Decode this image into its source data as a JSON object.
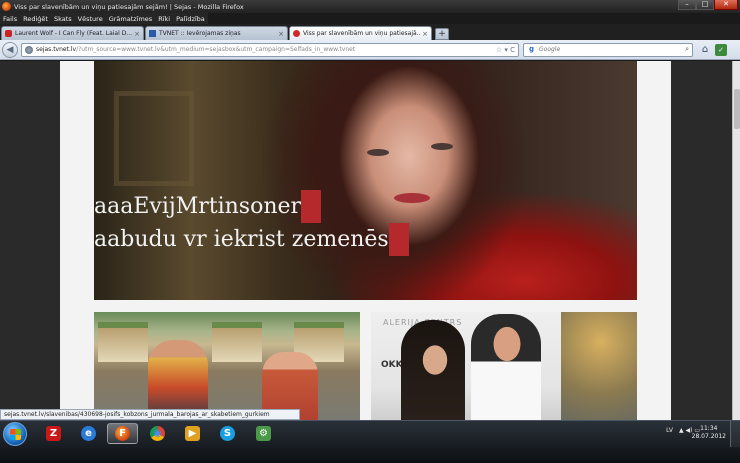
{
  "window": {
    "title": "Viss par slavenībām un viņu patiesajām sejām! | Sejas - Mozilla Firefox",
    "minimize": "–",
    "maximize": "□",
    "close": "✕"
  },
  "menu": {
    "items": [
      "Fails",
      "Rediģēt",
      "Skats",
      "Vēsture",
      "Grāmatzīmes",
      "Rīki",
      "Palīdzība"
    ]
  },
  "tabs": [
    {
      "label": "Laurent Wolf - I Can Fly (Feat. Laial D...",
      "icon": "youtube-icon",
      "color": "#cc2222"
    },
    {
      "label": "TVNET :: Ievērojamas ziņas",
      "icon": "tvnet-icon",
      "color": "#2a5aa8"
    },
    {
      "label": "Viss par slavenībām un viņu patiesajā...",
      "icon": "sejas-icon",
      "color": "#d02a2a"
    }
  ],
  "newtab": "+",
  "nav": {
    "back": "◀",
    "url_domain": "sejas.tvnet.lv",
    "url_rest": "/?utm_source=www.tvnet.lv&utm_medium=sejasbox&utm_campaign=Selfads_in_www.tvnet",
    "url_icons": "☆ ▾ C",
    "search_engine": "g",
    "search_placeholder": "Google",
    "search_btn": "⌕",
    "home": "⌂",
    "addon": "✓"
  },
  "hero": {
    "line1": "aaaEvijMrtinsoner",
    "line2": "aabudu vr iekrist zemenēs"
  },
  "cards": {
    "right_banner": "ALERIJA CENTRS",
    "okki": "OKKI"
  },
  "status": {
    "text": "sejas.tvnet.lv/slavenibas/430698-josifs_kobzons_jurmala_barojas_ar_skabetiem_gurkiem"
  },
  "taskbar": {
    "apps": [
      {
        "name": "zylom-app",
        "glyph": "Z",
        "color": "#c81818"
      },
      {
        "name": "internet-explorer-app",
        "glyph": "e",
        "color": "#2a7ad8"
      },
      {
        "name": "firefox-app",
        "glyph": "F",
        "color": "#e07020"
      },
      {
        "name": "chrome-app",
        "glyph": "◉",
        "color": "#3aa84a"
      },
      {
        "name": "media-player-app",
        "glyph": "▶",
        "color": "#e0a020"
      },
      {
        "name": "skype-app",
        "glyph": "S",
        "color": "#1aa0e0"
      },
      {
        "name": "app-generic",
        "glyph": "⚙",
        "color": "#4a9a4a"
      }
    ],
    "lang": "LV",
    "tray_icons": "▲ ◀) ▭",
    "time": "11:34",
    "date": "28.07.2012"
  }
}
